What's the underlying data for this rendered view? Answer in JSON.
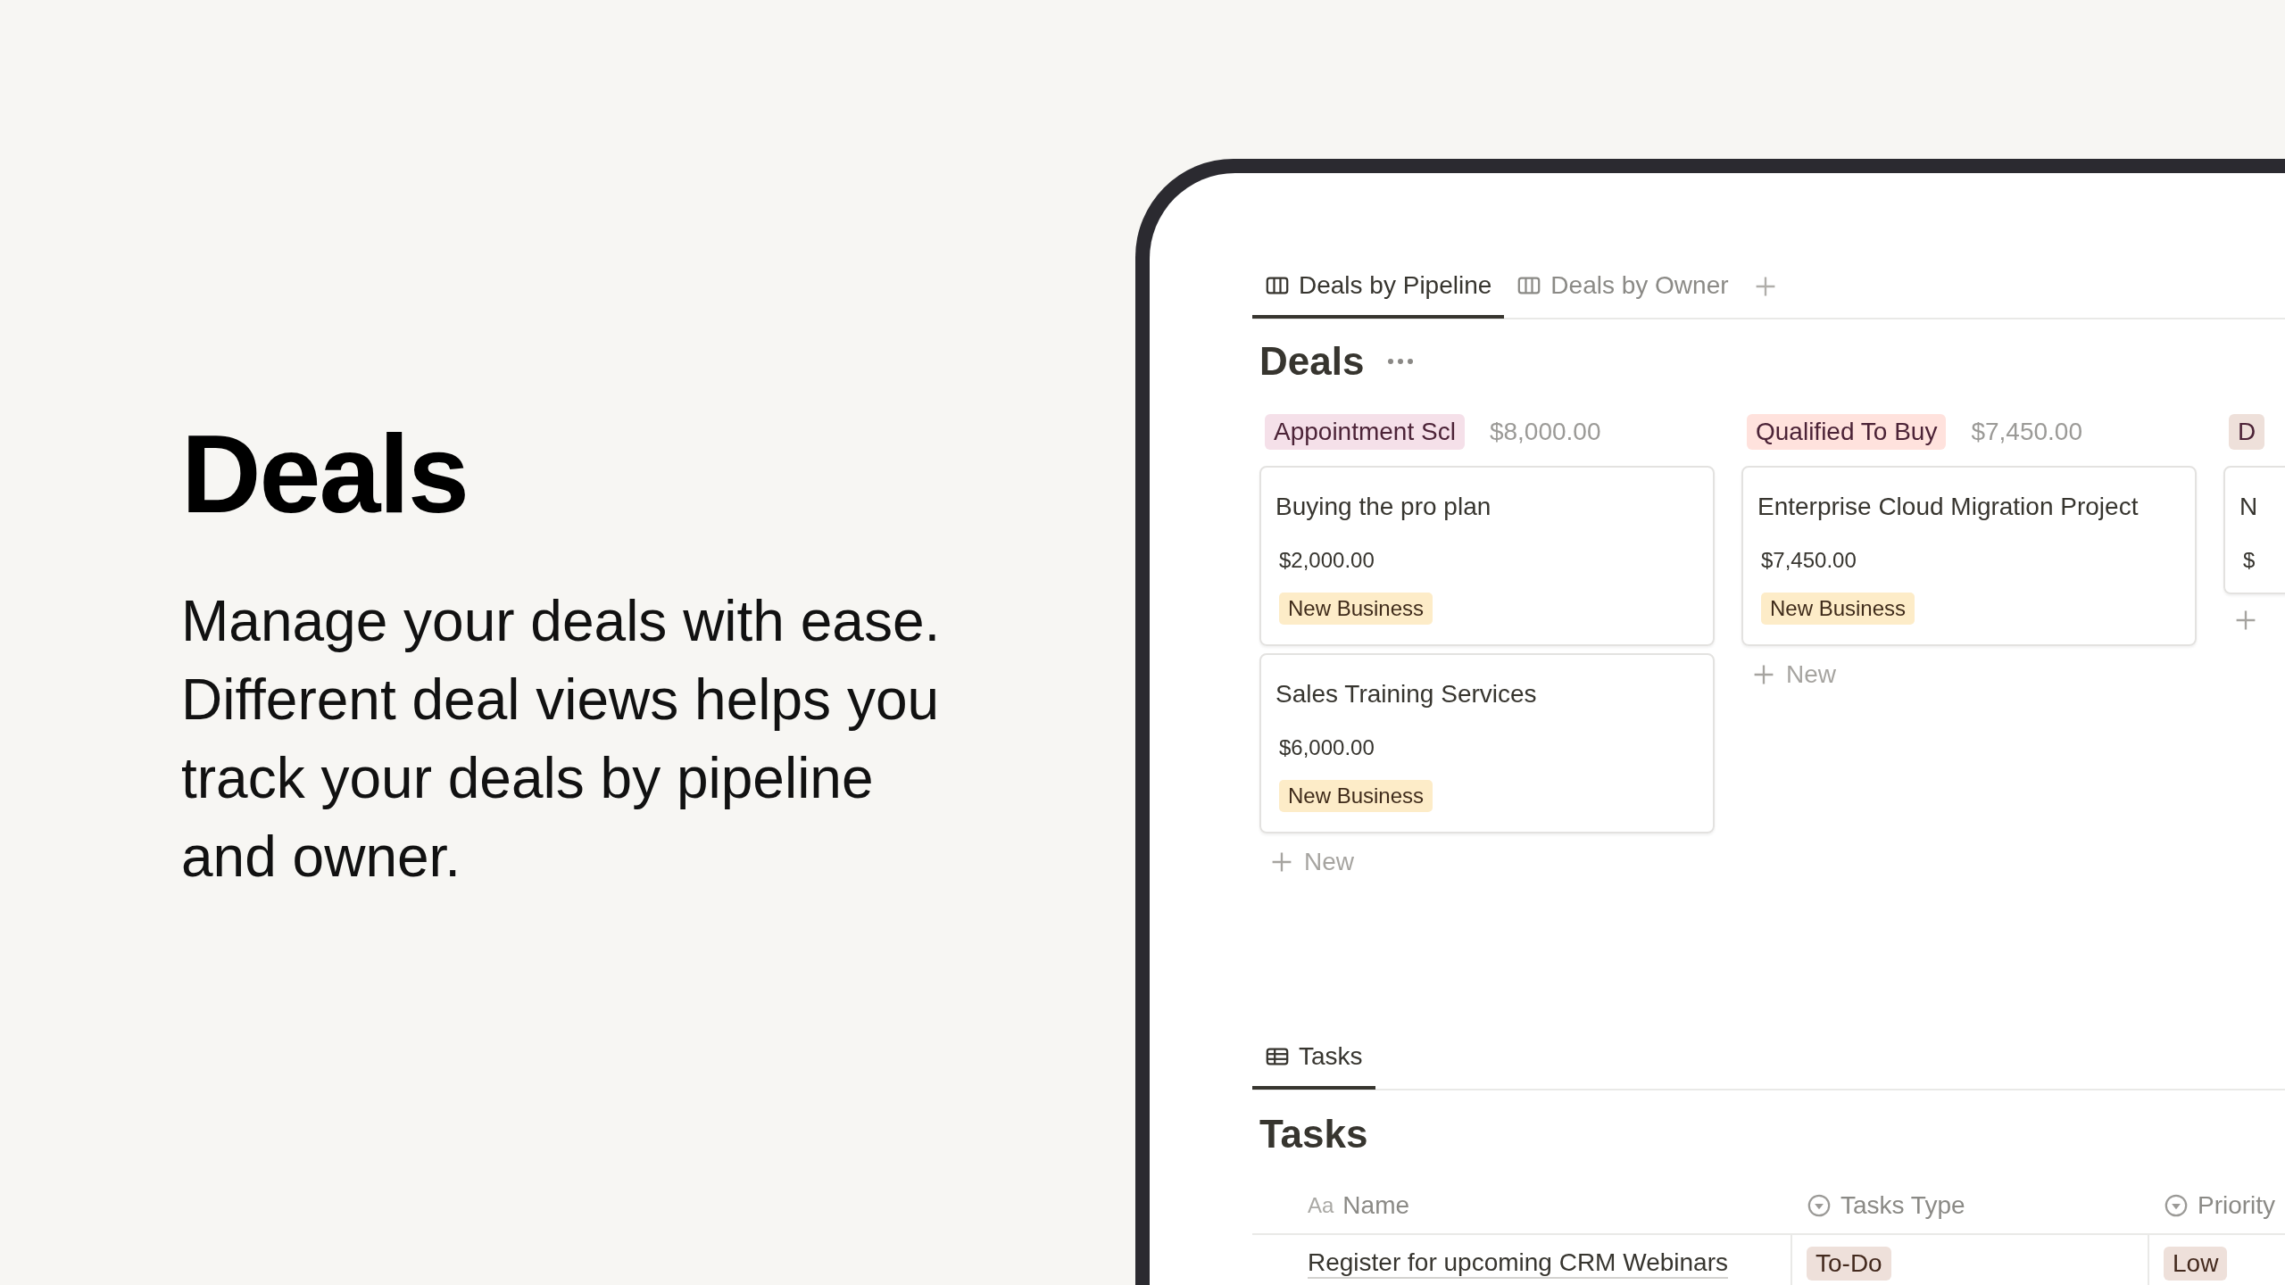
{
  "hero": {
    "title": "Deals",
    "description": "Manage your deals with ease. Different deal views helps you track your deals by pipeline and owner."
  },
  "view_tabs": [
    {
      "label": "Deals by Pipeline",
      "selected": true
    },
    {
      "label": "Deals by Owner",
      "selected": false
    }
  ],
  "board": {
    "title": "Deals",
    "groups": [
      {
        "label": "Appointment Scl",
        "total": "$8,000.00",
        "color": "#f5e0e9",
        "new_label": "New",
        "cards": [
          {
            "title": "Buying the pro plan",
            "amount": "$2,000.00",
            "tag": "New Business"
          },
          {
            "title": "Sales Training Services",
            "amount": "$6,000.00",
            "tag": "New Business"
          }
        ]
      },
      {
        "label": "Qualified To Buy",
        "total": "$7,450.00",
        "color": "#ffe2dd",
        "new_label": "New",
        "cards": [
          {
            "title": "Enterprise Cloud Migration Project",
            "amount": "$7,450.00",
            "tag": "New Business"
          }
        ]
      },
      {
        "label": "D",
        "color": "#eee0da",
        "cards": [
          {
            "title": "N",
            "amount": "$"
          }
        ]
      }
    ]
  },
  "tasks": {
    "tabs": [
      {
        "label": "Tasks",
        "selected": true
      }
    ],
    "title": "Tasks",
    "columns": [
      {
        "label": "Name",
        "kind": "title",
        "icon_text": "Aa"
      },
      {
        "label": "Tasks Type",
        "kind": "select"
      },
      {
        "label": "Priority",
        "kind": "select"
      }
    ],
    "rows": [
      {
        "name": "Register for upcoming CRM Webinars",
        "tasks_type": "To-Do",
        "priority": "Low"
      }
    ]
  }
}
